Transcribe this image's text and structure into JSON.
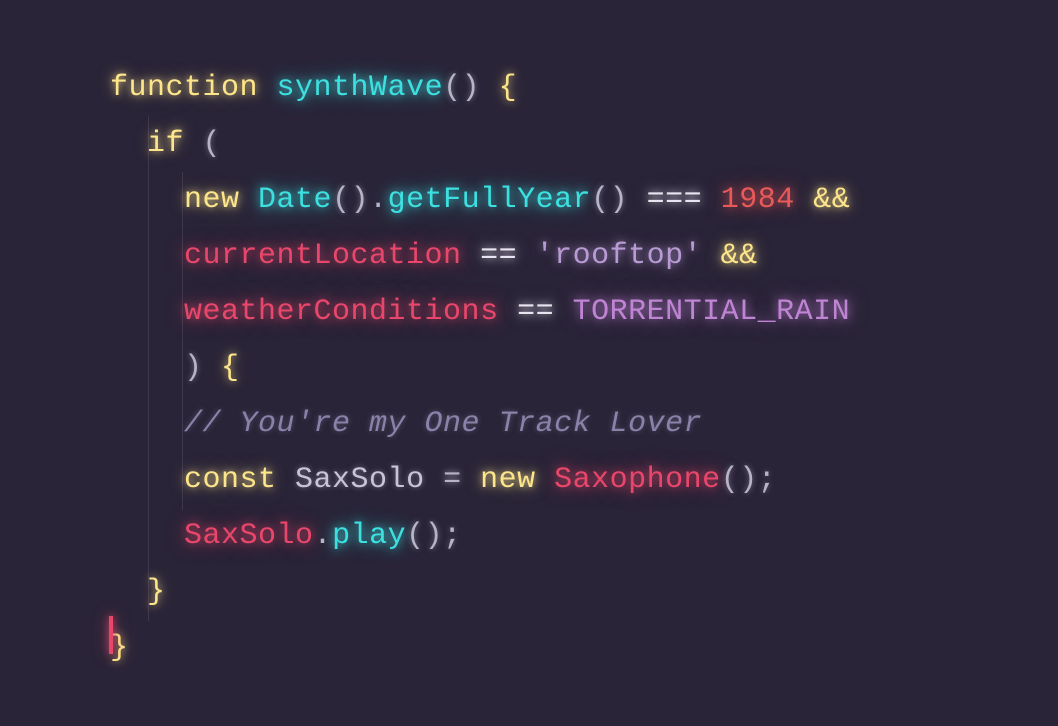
{
  "code": {
    "l1_kw_function": "function",
    "l1_fn_name": "synthWave",
    "l2_kw_if": "if",
    "l3_kw_new": "new",
    "l3_class_date": "Date",
    "l3_method": "getFullYear",
    "l3_op_eq3": "===",
    "l3_num": "1984",
    "l3_op_and": "&&",
    "l4_ident": "currentLocation",
    "l4_op_eq2": "==",
    "l4_str": "'rooftop'",
    "l4_op_and": "&&",
    "l5_ident": "weatherConditions",
    "l5_op_eq2": "==",
    "l5_const": "TORRENTIAL_RAIN",
    "l7_comment": "// You're my One Track Lover",
    "l8_kw_const": "const",
    "l8_var": "SaxSolo",
    "l8_kw_new": "new",
    "l8_class": "Saxophone",
    "l9_obj": "SaxSolo",
    "l9_method": "play"
  }
}
